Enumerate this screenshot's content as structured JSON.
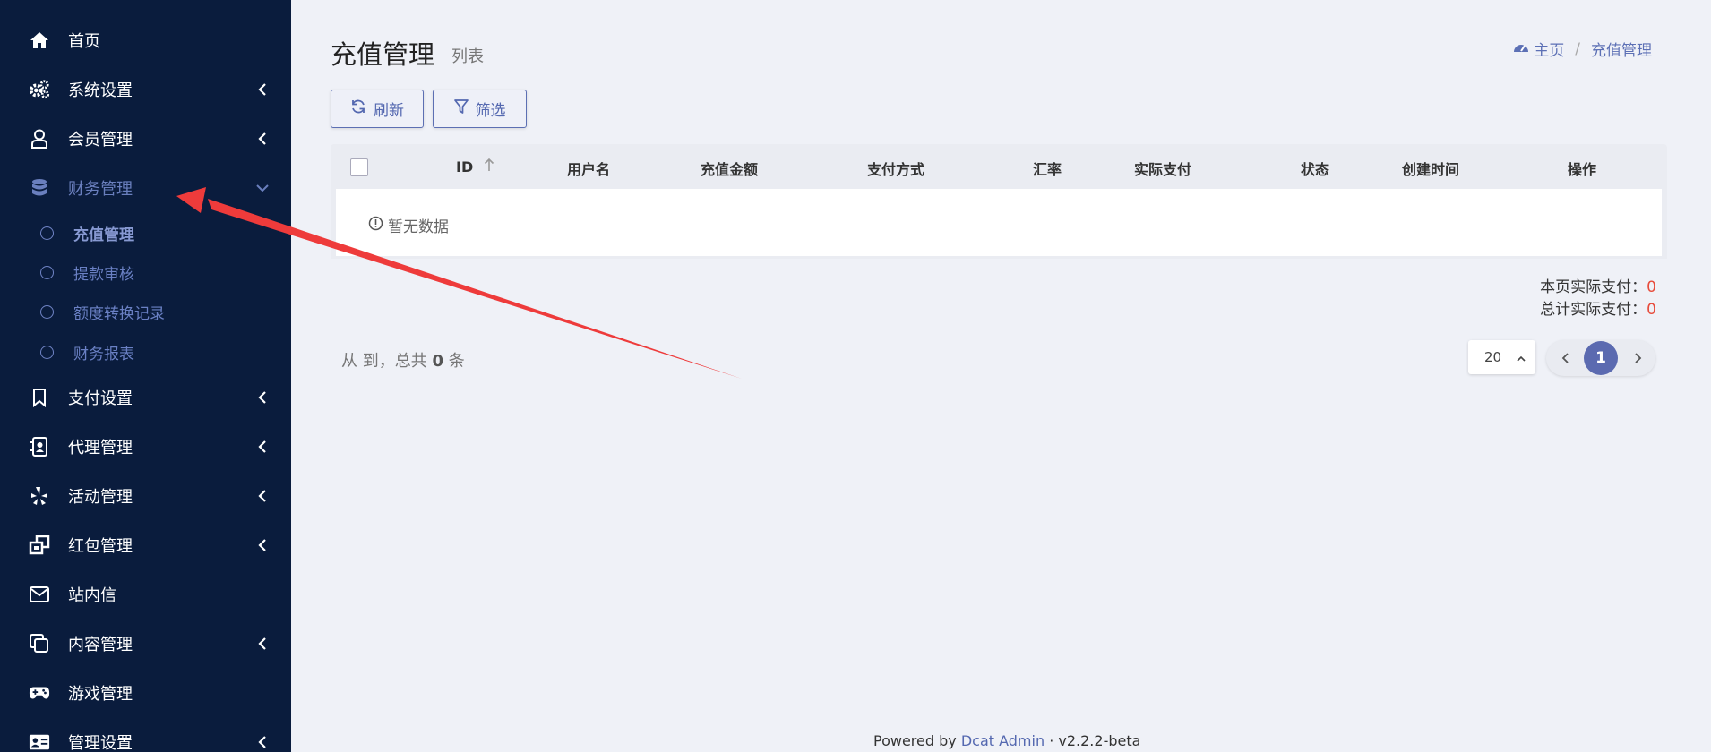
{
  "sidebar": {
    "items": [
      {
        "label": "首页",
        "icon": "home-icon"
      },
      {
        "label": "系统设置",
        "icon": "gears-icon"
      },
      {
        "label": "会员管理",
        "icon": "user-icon"
      },
      {
        "label": "财务管理",
        "icon": "database-icon"
      },
      {
        "label": "支付设置",
        "icon": "bookmark-icon"
      },
      {
        "label": "代理管理",
        "icon": "contact-book-icon"
      },
      {
        "label": "活动管理",
        "icon": "yelp-icon"
      },
      {
        "label": "红包管理",
        "icon": "clone-icon"
      },
      {
        "label": "站内信",
        "icon": "envelope-icon"
      },
      {
        "label": "内容管理",
        "icon": "copy-icon"
      },
      {
        "label": "游戏管理",
        "icon": "gamepad-icon"
      },
      {
        "label": "管理设置",
        "icon": "id-card-icon"
      }
    ],
    "finance_sub": [
      {
        "label": "充值管理"
      },
      {
        "label": "提款审核"
      },
      {
        "label": "额度转换记录"
      },
      {
        "label": "财务报表"
      }
    ]
  },
  "header": {
    "title": "充值管理",
    "subtitle": "列表",
    "breadcrumb_home": "主页",
    "breadcrumb_current": "充值管理",
    "breadcrumb_sep": "/"
  },
  "toolbar": {
    "refresh_label": "刷新",
    "filter_label": "筛选"
  },
  "table": {
    "columns": [
      "ID",
      "用户名",
      "充值金额",
      "支付方式",
      "汇率",
      "实际支付",
      "状态",
      "创建时间",
      "操作"
    ],
    "empty_text": "暂无数据"
  },
  "summary": {
    "page_label": "本页实际支付：",
    "page_value": "0",
    "total_label": "总计实际支付：",
    "total_value": "0"
  },
  "pager": {
    "info_prefix": "从 到，总共",
    "total": "0",
    "info_suffix": "条",
    "per_page": "20",
    "current_page": "1"
  },
  "footer": {
    "powered_by": "Powered by",
    "brand": "Dcat Admin",
    "dot": "·",
    "version": "v2.2.2-beta"
  },
  "colors": {
    "sidebar_bg": "#0a1c3d",
    "accent": "#5b6ab0",
    "arrow": "#ee3b3b",
    "highlight_value": "#e74c3c"
  }
}
